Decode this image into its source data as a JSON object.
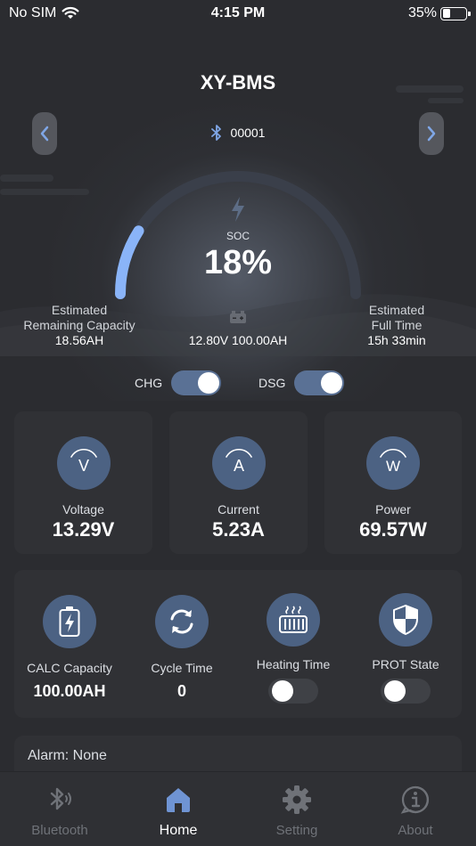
{
  "status_bar": {
    "carrier": "No SIM",
    "time": "4:15 PM",
    "battery_percent": "35%",
    "battery_level": 0.35
  },
  "header": {
    "title": "XY-BMS",
    "device_id": "00001",
    "bluetooth_icon": "bluetooth-icon"
  },
  "gauge": {
    "label": "SOC",
    "value_text": "18%",
    "soc": 0.18,
    "track_color": "#3a3f4a",
    "fill_color": "#8ab4f8"
  },
  "estimates": {
    "remaining_label_1": "Estimated",
    "remaining_label_2": "Remaining Capacity",
    "remaining_value": "18.56AH",
    "battery_value": "12.80V 100.00AH",
    "full_label_1": "Estimated",
    "full_label_2": "Full Time",
    "full_value": "15h 33min"
  },
  "switches": {
    "chg_label": "CHG",
    "chg_on": true,
    "dsg_label": "DSG",
    "dsg_on": true
  },
  "metrics": [
    {
      "label": "Voltage",
      "value": "13.29V",
      "icon": "voltage-icon",
      "glyph": "V"
    },
    {
      "label": "Current",
      "value": "5.23A",
      "icon": "current-icon",
      "glyph": "A"
    },
    {
      "label": "Power",
      "value": "69.57W",
      "icon": "power-icon",
      "glyph": "W"
    }
  ],
  "status_items": {
    "calc_capacity": {
      "label": "CALC Capacity",
      "value": "100.00AH",
      "icon": "battery-charge-icon"
    },
    "cycle_time": {
      "label": "Cycle Time",
      "value": "0",
      "icon": "cycle-icon"
    },
    "heating_time": {
      "label": "Heating Time",
      "on": false,
      "icon": "heater-icon"
    },
    "prot_state": {
      "label": "PROT State",
      "on": false,
      "icon": "shield-icon"
    }
  },
  "alarm": {
    "text": "Alarm: None"
  },
  "tabs": [
    {
      "label": "Bluetooth",
      "icon": "bluetooth-icon",
      "active": false
    },
    {
      "label": "Home",
      "icon": "home-icon",
      "active": true
    },
    {
      "label": "Setting",
      "icon": "gear-icon",
      "active": false
    },
    {
      "label": "About",
      "icon": "info-icon",
      "active": false
    }
  ],
  "colors": {
    "accent": "#4c6283",
    "background": "#2b2c30",
    "card": "#303135"
  }
}
